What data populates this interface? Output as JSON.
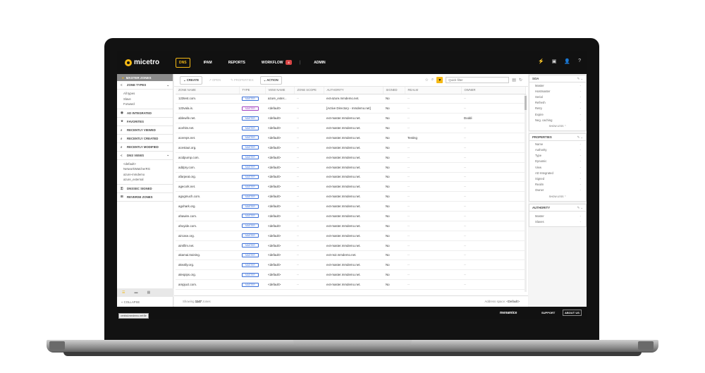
{
  "app": {
    "logo": "micetro"
  },
  "nav": {
    "items": [
      {
        "label": "DNS",
        "active": true
      },
      {
        "label": "IPAM"
      },
      {
        "label": "REPORTS"
      },
      {
        "label": "WORKFLOW",
        "badge": "4"
      },
      {
        "label": "ADMIN"
      }
    ]
  },
  "sidebar": {
    "header": "MASTER ZONES",
    "zone_types": {
      "label": "ZONE TYPES",
      "items": [
        "All types",
        "Slave",
        "Forward"
      ]
    },
    "sections": [
      "AD INTEGRATED",
      "FAVORITES",
      "RECENTLY VIEWED",
      "RECENTLY CREATED",
      "RECENTLY MODIFIED"
    ],
    "dns_views": {
      "label": "DNS VIEWS",
      "items": [
        "<default>",
        "NetworkWatcherRG",
        "azure-mmdemo",
        "azure_external"
      ]
    },
    "bottom_sections": [
      "DNSSEC SIGNED",
      "REVERSE ZONES"
    ],
    "collapse": "COLLAPSE"
  },
  "toolbar": {
    "create": "CREATE",
    "open": "OPEN",
    "properties": "PROPERTIES",
    "action": "ACTION",
    "quick_filter_placeholder": "Quick filter"
  },
  "table": {
    "columns": [
      "ZONE NAME",
      "TYPE",
      "VIEW NAME",
      "ZONE SCOPE",
      "AUTHORITY",
      "SIGNED",
      "REALM",
      "OWNER"
    ],
    "rows": [
      {
        "zone": "123test.com.",
        "type": "MASTER",
        "view": "azure_exter...",
        "scope": "--",
        "authority": "ext-azure.mmdemo.net.",
        "signed": "No",
        "realm": "--",
        "owner": "--"
      },
      {
        "zone": "123vala.is.",
        "type": "MASTER",
        "view": "<default>",
        "scope": "--",
        "authority": "[Active Directory - mmdemo.net]",
        "signed": "No",
        "realm": "--",
        "owner": "--"
      },
      {
        "zone": "ablewife.net.",
        "type": "MASTER",
        "view": "<default>",
        "scope": "--",
        "authority": "ext-master.mmdemo.net.",
        "signed": "No",
        "realm": "--",
        "owner": "Doddi"
      },
      {
        "zone": "acehits.net.",
        "type": "MASTER",
        "view": "<default>",
        "scope": "--",
        "authority": "ext-master.mmdemo.net.",
        "signed": "No",
        "realm": "--",
        "owner": "--"
      },
      {
        "zone": "acereps.net.",
        "type": "MASTER",
        "view": "<default>",
        "scope": "--",
        "authority": "ext-master.mmdemo.net.",
        "signed": "No",
        "realm": "Testing",
        "owner": "--"
      },
      {
        "zone": "acestaut.org.",
        "type": "MASTER",
        "view": "<default>",
        "scope": "--",
        "authority": "ext-master.mmdemo.net.",
        "signed": "No",
        "realm": "--",
        "owner": "--"
      },
      {
        "zone": "acidpump.com.",
        "type": "MASTER",
        "view": "<default>",
        "scope": "--",
        "authority": "ext-master.mmdemo.net.",
        "signed": "No",
        "realm": "--",
        "owner": "--"
      },
      {
        "zone": "addpry.com.",
        "type": "MASTER",
        "view": "<default>",
        "scope": "--",
        "authority": "ext-master.mmdemo.net.",
        "signed": "No",
        "realm": "--",
        "owner": "--"
      },
      {
        "zone": "afarpeat.org.",
        "type": "MASTER",
        "view": "<default>",
        "scope": "--",
        "authority": "ext-master.mmdemo.net.",
        "signed": "No",
        "realm": "--",
        "owner": "--"
      },
      {
        "zone": "agecork.net.",
        "type": "MASTER",
        "view": "<default>",
        "scope": "--",
        "authority": "ext-master.mmdemo.net.",
        "signed": "No",
        "realm": "--",
        "owner": "--"
      },
      {
        "zone": "agogmuch.com.",
        "type": "MASTER",
        "view": "<default>",
        "scope": "--",
        "authority": "ext-master.mmdemo.net.",
        "signed": "No",
        "realm": "--",
        "owner": "--"
      },
      {
        "zone": "agohark.org.",
        "type": "MASTER",
        "view": "<default>",
        "scope": "--",
        "authority": "ext-master.mmdemo.net.",
        "signed": "No",
        "realm": "--",
        "owner": "--"
      },
      {
        "zone": "ahawire.com.",
        "type": "MASTER",
        "view": "<default>",
        "scope": "--",
        "authority": "ext-master.mmdemo.net.",
        "signed": "No",
        "realm": "--",
        "owner": "--"
      },
      {
        "zone": "ahoyide.com.",
        "type": "MASTER",
        "view": "<default>",
        "scope": "--",
        "authority": "ext-master.mmdemo.net.",
        "signed": "No",
        "realm": "--",
        "owner": "--"
      },
      {
        "zone": "aircase.org.",
        "type": "MASTER",
        "view": "<default>",
        "scope": "--",
        "authority": "ext-master.mmdemo.net.",
        "signed": "No",
        "realm": "--",
        "owner": "--"
      },
      {
        "zone": "airsfilm.net.",
        "type": "MASTER",
        "view": "<default>",
        "scope": "--",
        "authority": "ext-master.mmdemo.net.",
        "signed": "No",
        "realm": "--",
        "owner": "--"
      },
      {
        "zone": "akamai.training.",
        "type": "MASTER",
        "view": "<default>",
        "scope": "--",
        "authority": "ext-ns2.mmdemo.net.",
        "signed": "No",
        "realm": "--",
        "owner": "--"
      },
      {
        "zone": "akeally.org.",
        "type": "MASTER",
        "view": "<default>",
        "scope": "--",
        "authority": "ext-master.mmdemo.net.",
        "signed": "No",
        "realm": "--",
        "owner": "--"
      },
      {
        "zone": "alespips.org.",
        "type": "MASTER",
        "view": "<default>",
        "scope": "--",
        "authority": "ext-master.mmdemo.net.",
        "signed": "No",
        "realm": "--",
        "owner": "--"
      },
      {
        "zone": "ampjuct.com.",
        "type": "MASTER",
        "view": "<default>",
        "scope": "--",
        "authority": "ext-master.mmdemo.net.",
        "signed": "No",
        "realm": "--",
        "owner": "--"
      }
    ],
    "footer_prefix": "Showing",
    "count": "1147",
    "footer_suffix": "zones",
    "address_space_label": "Address space:",
    "address_space_value": "<Default>"
  },
  "right_panel": {
    "soa": {
      "title": "SOA",
      "fields": [
        "Master",
        "Hostmaster",
        "Serial",
        "Refresh",
        "Retry",
        "Expire",
        "Neg. caching"
      ],
      "show_less": "SHOW LESS"
    },
    "properties": {
      "title": "PROPERTIES",
      "fields": [
        "Name",
        "Authority",
        "Type",
        "Dynamic",
        "View",
        "AD Integrated",
        "Signed",
        "Realm",
        "Owner"
      ],
      "show_less": "SHOW LESS"
    },
    "authority": {
      "title": "AUTHORITY",
      "fields": [
        "Master",
        "Slaves"
      ]
    }
  },
  "bottombar": {
    "host": "central.mmdemo.net:8e",
    "brand": "menamice",
    "support": "SUPPORT",
    "about": "ABOUT US"
  }
}
